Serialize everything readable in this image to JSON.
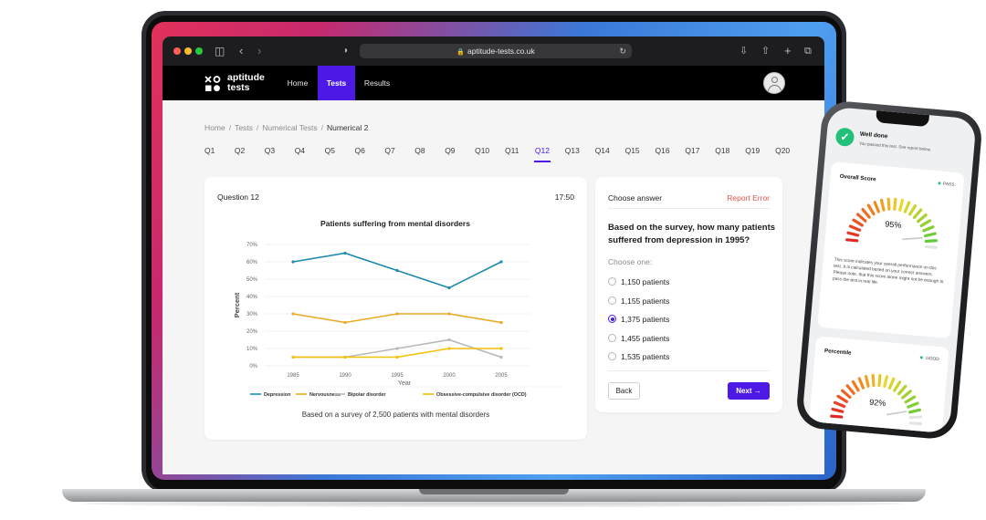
{
  "browser": {
    "url": "aptitude-tests.co.uk",
    "colors": {
      "accent": "#4c19e6",
      "nav_bg": "#000000",
      "report": "#e4574a"
    }
  },
  "site": {
    "logo_text": "aptitude\ntests",
    "nav": [
      {
        "label": "Home",
        "active": false
      },
      {
        "label": "Tests",
        "active": true
      },
      {
        "label": "Results",
        "active": false
      }
    ]
  },
  "breadcrumb": [
    "Home",
    "Tests",
    "Numerical Tests",
    "Numerical 2"
  ],
  "question_tabs": [
    "Q1",
    "Q2",
    "Q3",
    "Q4",
    "Q5",
    "Q6",
    "Q7",
    "Q8",
    "Q9",
    "Q10",
    "Q11",
    "Q12",
    "Q13",
    "Q14",
    "Q15",
    "Q16",
    "Q17",
    "Q18",
    "Q19",
    "Q20"
  ],
  "active_question": "Q12",
  "question": {
    "title": "Question 12",
    "timer": "17:50",
    "caption": "Based on a survey of 2,500 patients with mental disorders"
  },
  "chart_data": {
    "type": "line",
    "title": "Patients suffering from mental disorders",
    "xlabel": "Year",
    "ylabel": "Percent",
    "x": [
      1985,
      1990,
      1995,
      2000,
      2005
    ],
    "y_ticks": [
      "0%",
      "10%",
      "20%",
      "30%",
      "40%",
      "50%",
      "60%",
      "70%"
    ],
    "ylim": [
      0,
      70
    ],
    "grid": true,
    "legend_position": "bottom",
    "series": [
      {
        "name": "Depression",
        "values": [
          60,
          65,
          55,
          45,
          60
        ],
        "color": "#1f8aae"
      },
      {
        "name": "Nervousness",
        "values": [
          30,
          25,
          30,
          30,
          25
        ],
        "color": "#e8a923"
      },
      {
        "name": "Bipolar disorder",
        "values": [
          5,
          5,
          10,
          15,
          5
        ],
        "color": "#b8b8b8"
      },
      {
        "name": "Obsessive-compulsive disorder (OCD)",
        "values": [
          5,
          5,
          5,
          10,
          10
        ],
        "color": "#f2c200"
      }
    ]
  },
  "answer": {
    "header": "Choose answer",
    "report_label": "Report Error",
    "question_text": "Based on the survey, how many patients suffered from depression in 1995?",
    "choose_one": "Choose one:",
    "options": [
      {
        "label": "1,150 patients",
        "selected": false
      },
      {
        "label": "1,155 patients",
        "selected": false
      },
      {
        "label": "1,375 patients",
        "selected": true
      },
      {
        "label": "1,455 patients",
        "selected": false
      },
      {
        "label": "1,535 patients",
        "selected": false
      }
    ],
    "back_label": "Back",
    "next_label": "Next"
  },
  "phone": {
    "title": "Well done",
    "subtitle": "You passed this test. See report below.",
    "overall": {
      "title": "Overall Score",
      "status": "PASS",
      "score": "95%",
      "value": 0.95,
      "description": "This score indicates your overall performance on this test. It is calculated based on your correct answers. Please note, that this score alone might not be enough to pass the test in real life."
    },
    "percentile": {
      "title": "Percentile",
      "status": "GOOD",
      "score": "92%",
      "value": 0.92
    }
  }
}
